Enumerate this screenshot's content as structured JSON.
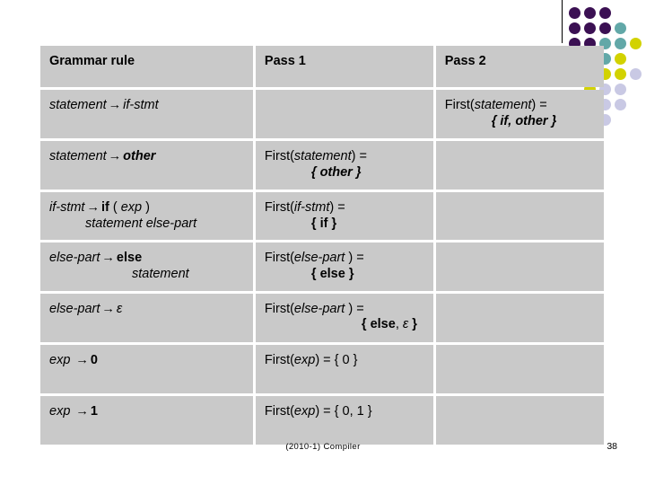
{
  "slide": {
    "footer_text": "(2010-1) Compiler",
    "page_number": "38"
  },
  "decor": {
    "colors": {
      "purple": "#3b1053",
      "teal": "#62a8a8",
      "yellow": "#d2d200",
      "lavender": "#c9c9e4"
    }
  },
  "table": {
    "headers": {
      "grammar_rule": "Grammar rule",
      "pass1": "Pass 1",
      "pass2": "Pass 2"
    },
    "rows": [
      {
        "rule": {
          "lhs": "statement",
          "arrow": "→",
          "rhs": "if-stmt"
        },
        "pass1": "",
        "pass2": {
          "line1_prefix": "First(",
          "line1_arg": "statement",
          "line1_suffix": ") =",
          "line2": "{ if, other  }"
        }
      },
      {
        "rule": {
          "lhs": "statement",
          "arrow": "→",
          "rhs": "other"
        },
        "pass1": {
          "line1_prefix": "First(",
          "line1_arg": "statement",
          "line1_suffix": ") =",
          "line2": "{ other  }"
        },
        "pass2": ""
      },
      {
        "rule": {
          "lhs": "if-stmt",
          "arrow": "→",
          "rhs_kw": "if",
          "rhs_paren_open": "(",
          "rhs_exp": "exp",
          "rhs_paren_close": ")",
          "line2": "statement else-part"
        },
        "pass1": {
          "line1_prefix": "First(",
          "line1_arg": "if-stmt",
          "line1_suffix": ") =",
          "line2": "{ if }"
        },
        "pass2": ""
      },
      {
        "rule": {
          "lhs": "else-part",
          "arrow": "→",
          "rhs_kw": "else",
          "line2": "statement"
        },
        "pass1": {
          "line1_prefix": "First(",
          "line1_arg": "else-part ",
          "line1_suffix": ") =",
          "line2": "{ else }"
        },
        "pass2": ""
      },
      {
        "rule": {
          "lhs": "else-part",
          "arrow": "→",
          "rhs_eps": "ε"
        },
        "pass1": {
          "line1_prefix": "First(",
          "line1_arg": "else-part ",
          "line1_suffix": ") =",
          "line2_a": "{ else",
          "line2_b": ", ",
          "line2_c": "ε",
          "line2_d": " }"
        },
        "pass2": ""
      },
      {
        "rule": {
          "lhs": "exp ",
          "arrow": "→",
          "rhs_num": "0"
        },
        "pass1": {
          "full_prefix": "First(",
          "full_arg": "exp",
          "full_suffix": ") = { 0 }"
        },
        "pass2": ""
      },
      {
        "rule": {
          "lhs": "exp ",
          "arrow": "→",
          "rhs_num": "1"
        },
        "pass1": {
          "full_prefix": "First(",
          "full_arg": "exp",
          "full_suffix": ") = { 0, 1 }"
        },
        "pass2": ""
      }
    ]
  }
}
